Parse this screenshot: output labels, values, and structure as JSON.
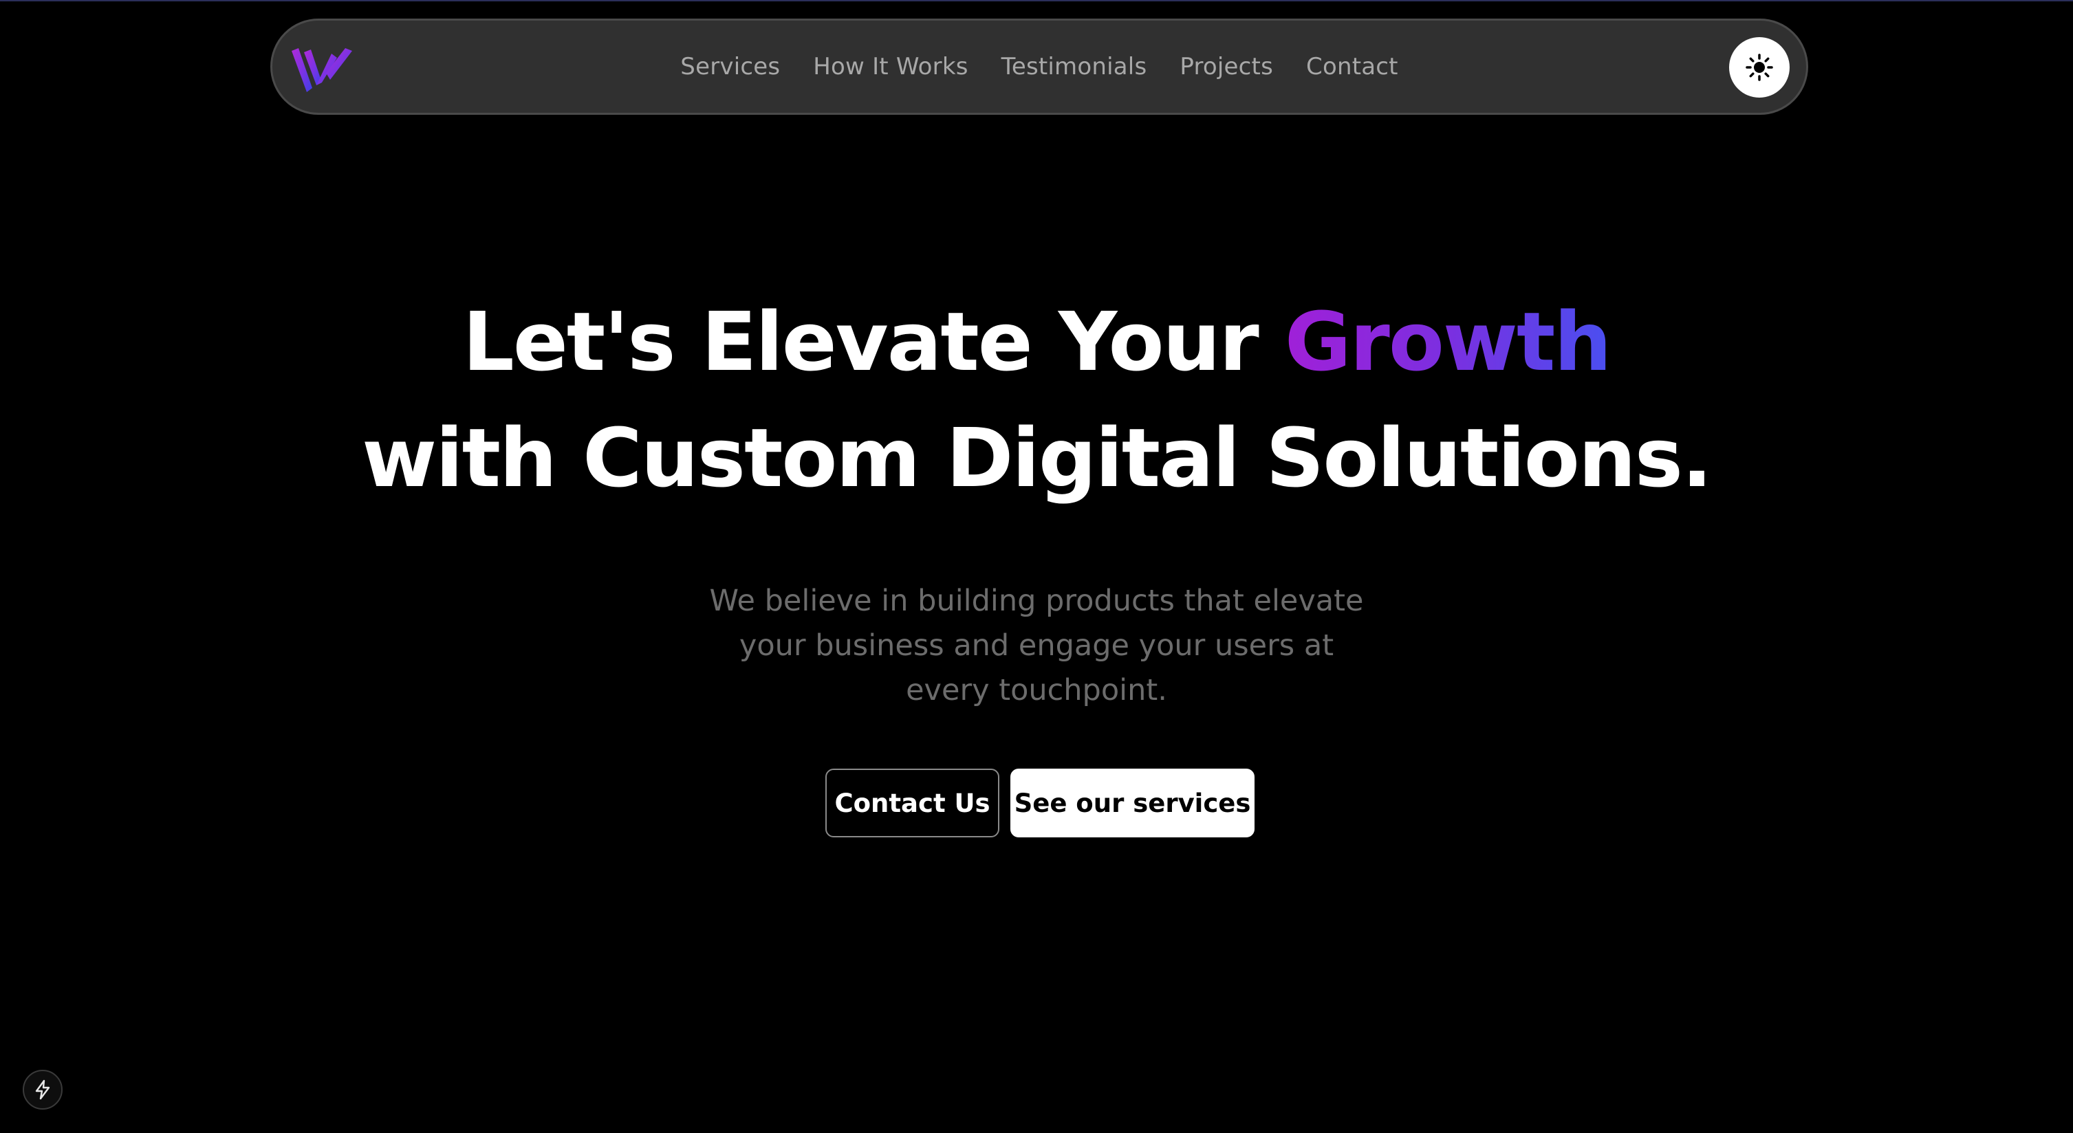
{
  "nav": {
    "links": [
      {
        "label": "Services"
      },
      {
        "label": "How It Works"
      },
      {
        "label": "Testimonials"
      },
      {
        "label": "Projects"
      },
      {
        "label": "Contact"
      }
    ],
    "logo_icon": "brand-w-logo",
    "theme_toggle_icon": "sun-icon"
  },
  "hero": {
    "title_line1_prefix": "Let's Elevate Your ",
    "title_line1_highlight": "Growth",
    "title_line2": "with Custom Digital Solutions.",
    "subtitle_lines": [
      "We believe in building products that elevate",
      "your business and engage your users at",
      "every touchpoint."
    ]
  },
  "cta": {
    "primary_label": "Contact Us",
    "secondary_label": "See our services"
  },
  "badge": {
    "icon": "lightning-bolt-icon"
  },
  "colors": {
    "background": "#000000",
    "navbar_bg": "#303030",
    "gradient_start": "#a020d8",
    "gradient_end": "#4a4ff0",
    "subtitle_text": "#6c6c6c"
  }
}
